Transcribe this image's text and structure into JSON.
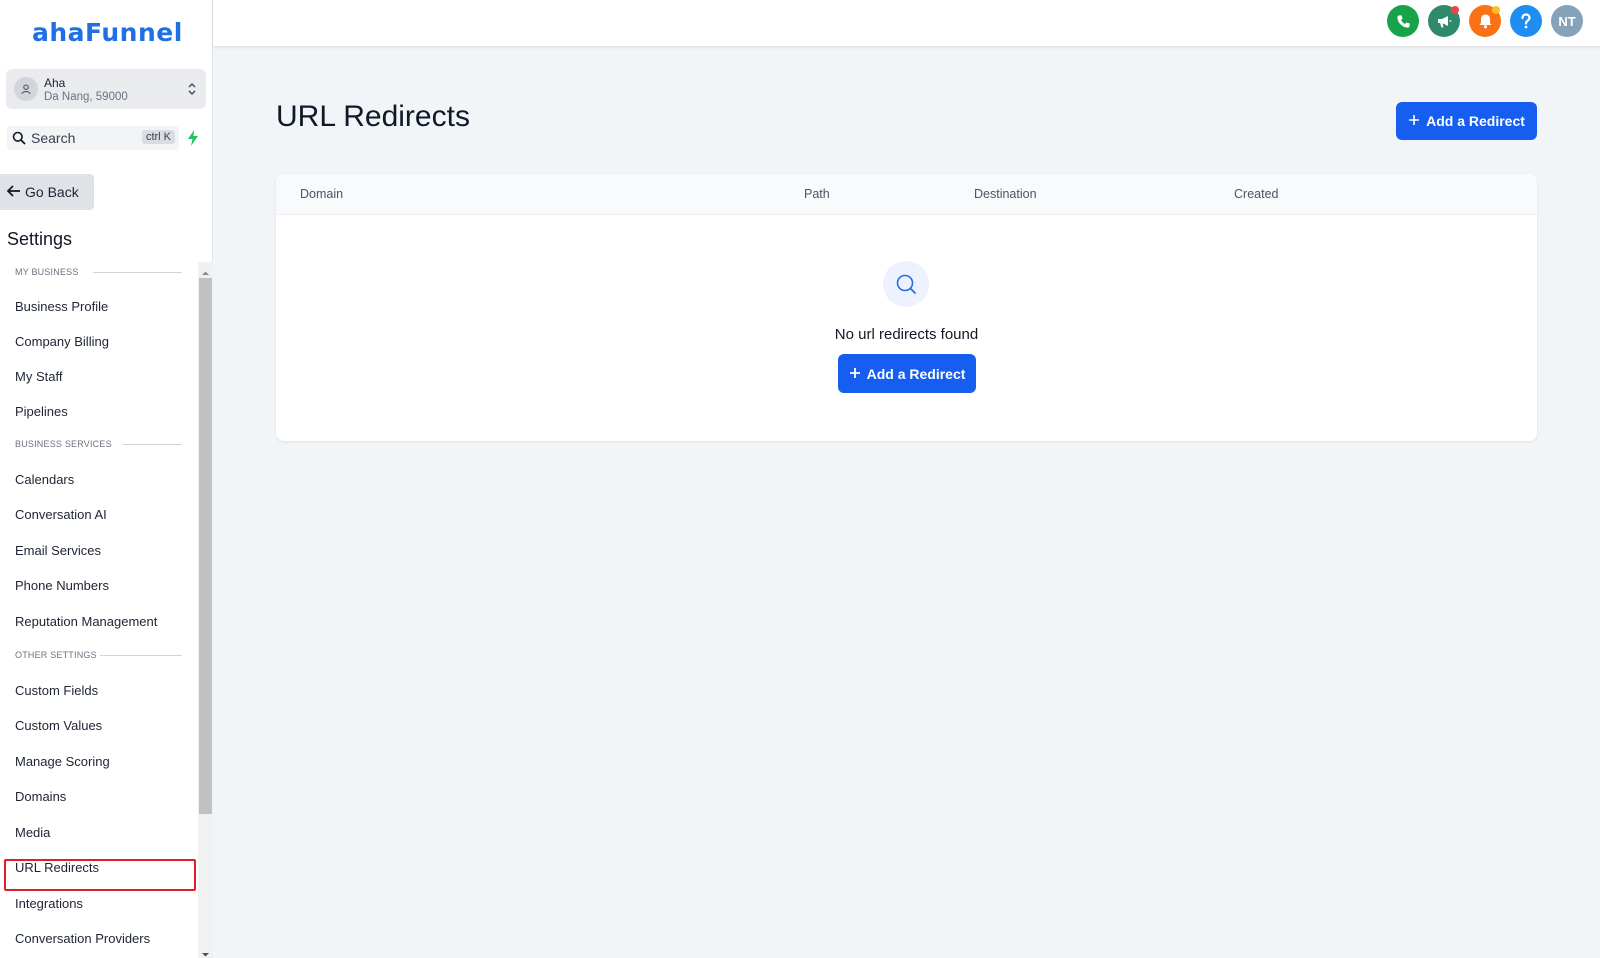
{
  "app": {
    "logo_text": "ahaFunnel",
    "brand_color": "#1f6fe5",
    "accent_color": "#155eef"
  },
  "account": {
    "name": "Aha",
    "location": "Da Nang, 59000"
  },
  "search": {
    "label": "Search",
    "shortcut": "ctrl K"
  },
  "sidebar": {
    "go_back": "Go Back",
    "title": "Settings",
    "sections": [
      {
        "heading": "MY BUSINESS",
        "items": [
          "Business Profile",
          "Company Billing",
          "My Staff",
          "Pipelines"
        ]
      },
      {
        "heading": "BUSINESS SERVICES",
        "items": [
          "Calendars",
          "Conversation AI",
          "Email Services",
          "Phone Numbers",
          "Reputation Management"
        ]
      },
      {
        "heading": "OTHER SETTINGS",
        "items": [
          "Custom Fields",
          "Custom Values",
          "Manage Scoring",
          "Domains",
          "Media",
          "URL Redirects",
          "Integrations",
          "Conversation Providers"
        ]
      }
    ],
    "active_item": "URL Redirects"
  },
  "topbar": {
    "icons": [
      {
        "name": "phone-icon",
        "color": "#16a34a"
      },
      {
        "name": "megaphone-icon",
        "color": "#2f8a6b",
        "badge_color": "#ef4444"
      },
      {
        "name": "bell-icon",
        "color": "#f97316",
        "badge_color": "#fbbf24"
      },
      {
        "name": "help-icon",
        "color": "#1f8ef1"
      },
      {
        "name": "user-avatar",
        "color": "#86a2b8",
        "initials": "NT"
      }
    ]
  },
  "main": {
    "title": "URL Redirects",
    "add_button": "Add a Redirect",
    "table": {
      "columns": [
        "Domain",
        "Path",
        "Destination",
        "Created"
      ]
    },
    "empty_state": {
      "text": "No url redirects found",
      "button": "Add a Redirect"
    }
  }
}
